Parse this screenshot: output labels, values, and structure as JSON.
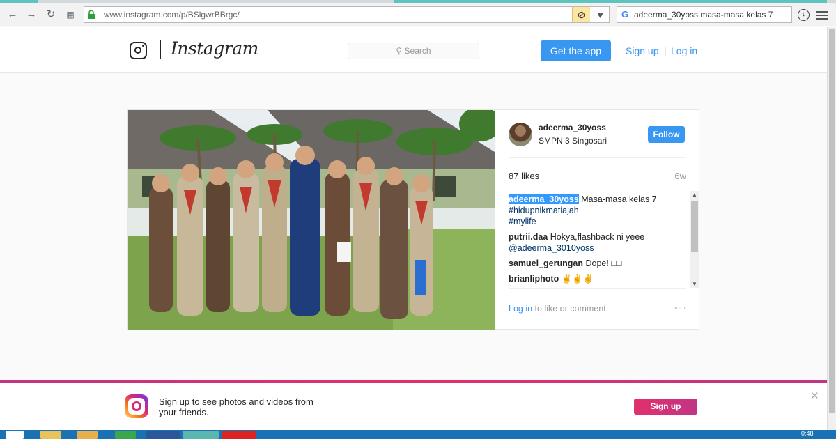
{
  "browser": {
    "url": "www.instagram.com/p/BSlgwrBBrgc/",
    "search_query": "adeerma_30yoss masa-masa kelas 7"
  },
  "header": {
    "logo_word": "Instagram",
    "search_placeholder": "Search",
    "get_app_label": "Get the app",
    "signup_label": "Sign up",
    "separator": "|",
    "login_label": "Log in"
  },
  "post": {
    "username": "adeerma_30yoss",
    "location": "SMPN 3 Singosari",
    "follow_label": "Follow",
    "likes": "87 likes",
    "age": "6w",
    "caption": {
      "user": "adeerma_30yoss",
      "text": "Masa-masa kelas 7",
      "tags": [
        "#hidupnikmatiajah",
        "#mylife"
      ]
    },
    "comments": [
      {
        "user": "putrii.daa",
        "text": "Hokya,flashback ni yeee",
        "mention": "@adeerma_3010yoss"
      },
      {
        "user": "samuel_gerungan",
        "text": "Dope! □□"
      },
      {
        "user": "brianliphoto",
        "text": "✌✌✌"
      }
    ],
    "login_link": "Log in",
    "login_rest": "to like or comment.",
    "more": "◦◦◦"
  },
  "banner": {
    "text": "Sign up to see photos and videos from your friends.",
    "signup_label": "Sign up",
    "close": "✕"
  },
  "taskbar": {
    "clock": "0:48"
  },
  "colors": {
    "accent": "#3897f0",
    "banner_gradient_start": "#e1306c",
    "banner_gradient_end": "#c13584"
  },
  "icons": [
    "back-icon",
    "forward-icon",
    "reload-icon",
    "apps-icon",
    "lock-icon",
    "block-icon",
    "heart-icon",
    "google-icon",
    "download-icon",
    "menu-icon",
    "instagram-glyph-icon",
    "search-icon",
    "instagram-app-icon",
    "close-icon"
  ]
}
